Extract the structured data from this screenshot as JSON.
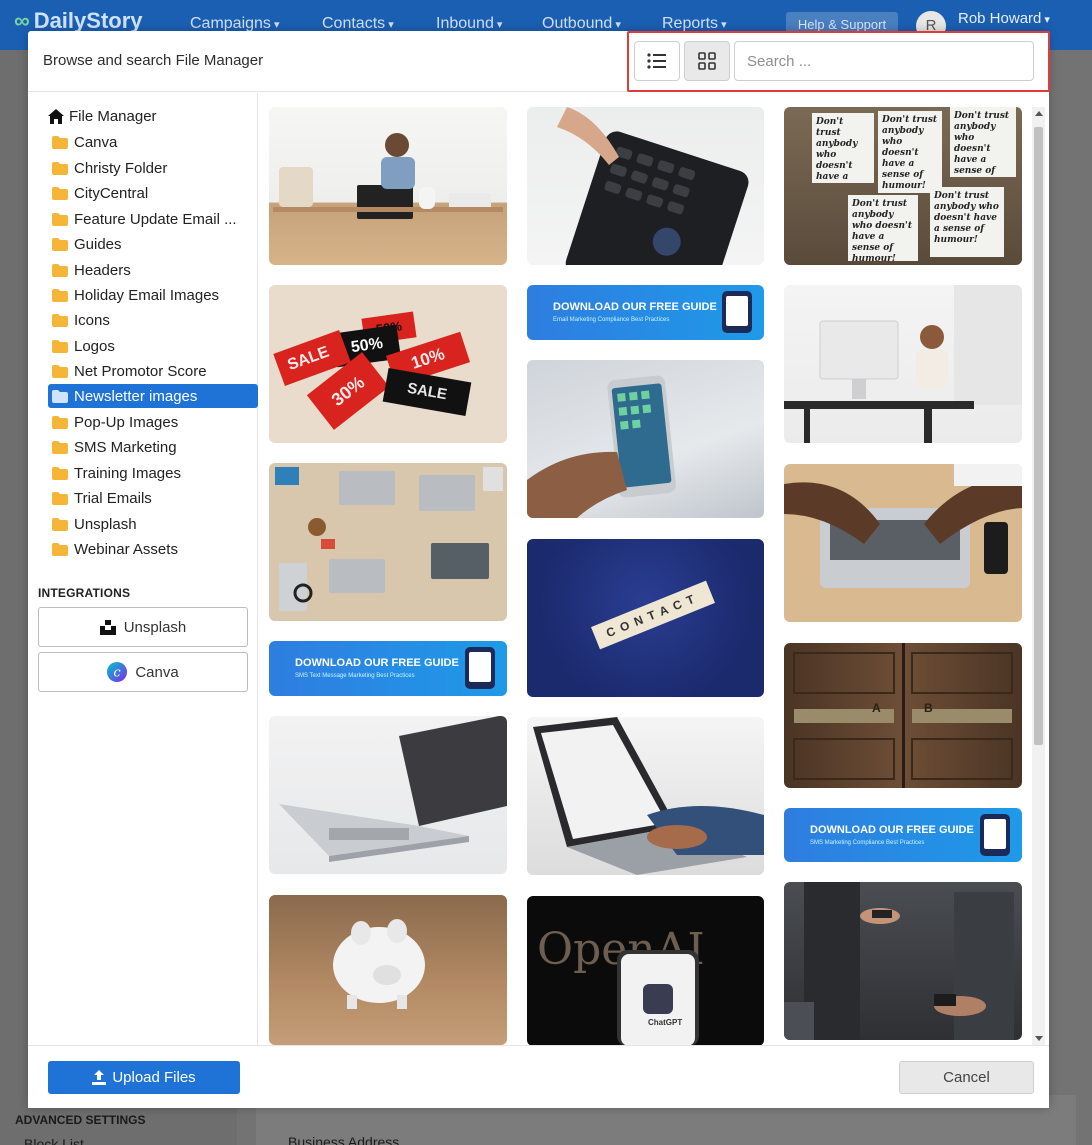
{
  "app": {
    "logo_text": "DailyStory",
    "nav": [
      "Campaigns",
      "Contacts",
      "Inbound",
      "Outbound",
      "Reports"
    ],
    "help_label": "Help & Support",
    "user_initial": "R",
    "user_name": "Rob Howard",
    "bg_labels": {
      "advanced_settings": "ADVANCED SETTINGS",
      "block_list": "Block List",
      "business_address": "Business Address"
    }
  },
  "modal": {
    "title": "Browse and search File Manager",
    "search_placeholder": "Search ...",
    "search_value": "",
    "view_mode": "grid",
    "list_view_icon": "list-icon",
    "grid_view_icon": "grid-icon"
  },
  "tree": {
    "root_label": "File Manager",
    "root_icon": "home-icon",
    "folder_icon": "folder-icon",
    "folders": [
      "Canva",
      "Christy Folder",
      "CityCentral",
      "Feature Update Email ...",
      "Guides",
      "Headers",
      "Holiday Email Images",
      "Icons",
      "Logos",
      "Net Promotor Score",
      "Newsletter images",
      "Pop-Up Images",
      "SMS Marketing",
      "Training Images",
      "Trial Emails",
      "Unsplash",
      "Webinar Assets"
    ],
    "selected_folder": "Newsletter images"
  },
  "integrations": {
    "title": "INTEGRATIONS",
    "unsplash_label": "Unsplash",
    "canva_label": "Canva"
  },
  "images": {
    "banner_title": "DOWNLOAD OUR FREE GUIDE",
    "banner_email_sub": "Email Marketing Compliance Best Practices",
    "banner_sms_text_sub": "SMS Text Message Marketing Best Practices",
    "banner_sms_sub": "SMS Marketing Compliance Best Practices",
    "sale_50a": "50%",
    "sale_50b": "50%",
    "sale_30": "30%",
    "sale_10": "10%",
    "sale_label": "SALE",
    "contact_tiles": "CONTACT",
    "humour_note": "Don't trust anybody who doesn't have a sense of humour!",
    "openai_text": "OpenAI",
    "chatgpt_label": "ChatGPT",
    "door_a": "A",
    "door_b": "B"
  },
  "footer": {
    "upload_label": "Upload Files",
    "cancel_label": "Cancel"
  },
  "colors": {
    "primary": "#1f72d6",
    "nav_bg": "#1b5fb3",
    "highlight": "#e03a3a",
    "folder_yellow": "#f5b637"
  }
}
